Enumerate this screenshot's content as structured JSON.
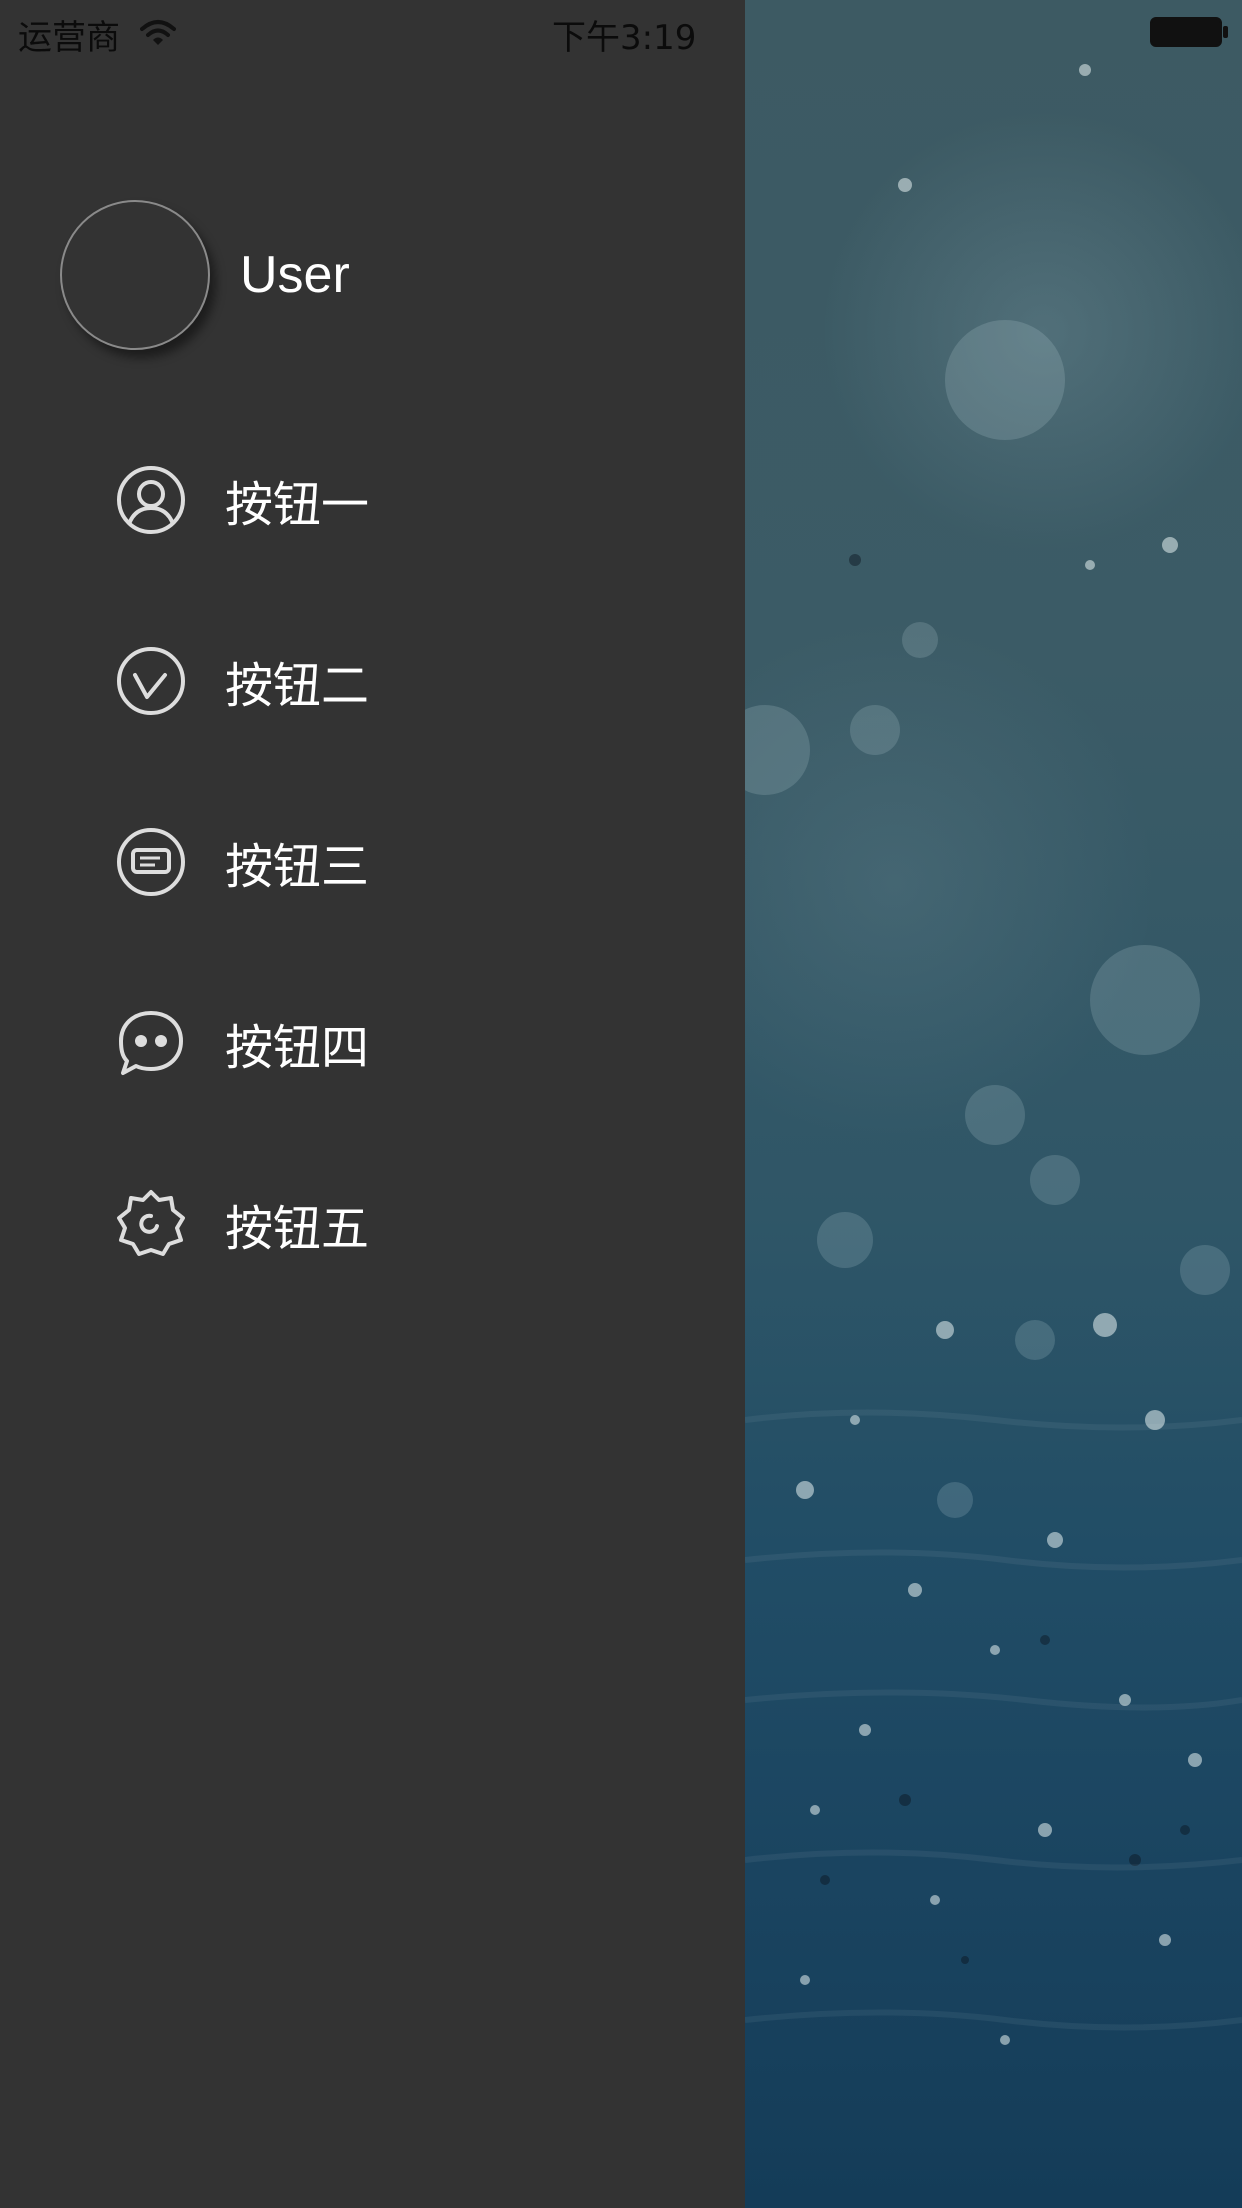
{
  "status_bar": {
    "carrier": "运营商",
    "time": "下午3:19"
  },
  "user": {
    "name": "User"
  },
  "menu": [
    {
      "label": "按钮一",
      "icon": "user-icon"
    },
    {
      "label": "按钮二",
      "icon": "check-circle-icon"
    },
    {
      "label": "按钮三",
      "icon": "message-icon"
    },
    {
      "label": "按钮四",
      "icon": "chat-bubble-icon"
    },
    {
      "label": "按钮五",
      "icon": "settings-gear-icon"
    }
  ],
  "colors": {
    "drawer_bg": "#333333",
    "icon_stroke": "#dddddd",
    "text": "#ffffff"
  }
}
